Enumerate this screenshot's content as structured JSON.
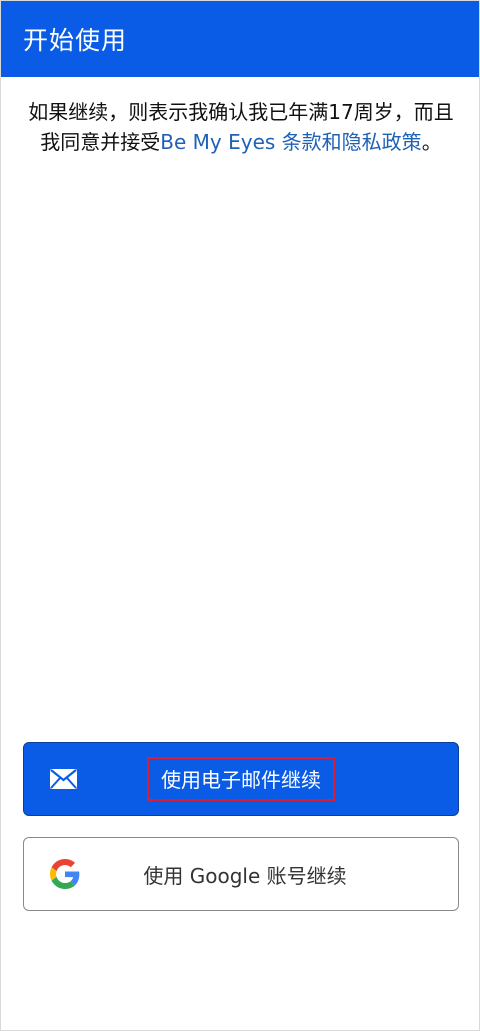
{
  "header": {
    "title": "开始使用"
  },
  "consent": {
    "text_before": "如果继续，则表示我确认我已年满17周岁，而且我同意并接受",
    "link_text": "Be My Eyes 条款和隐私政策",
    "text_after": "。"
  },
  "buttons": {
    "email_label": "使用电子邮件继续",
    "google_label": "使用 Google 账号继续"
  },
  "icons": {
    "email": "envelope-icon",
    "google": "google-logo-icon"
  },
  "colors": {
    "primary": "#0a5ce6",
    "link": "#1f61b7",
    "highlight_border": "#d6203a"
  }
}
